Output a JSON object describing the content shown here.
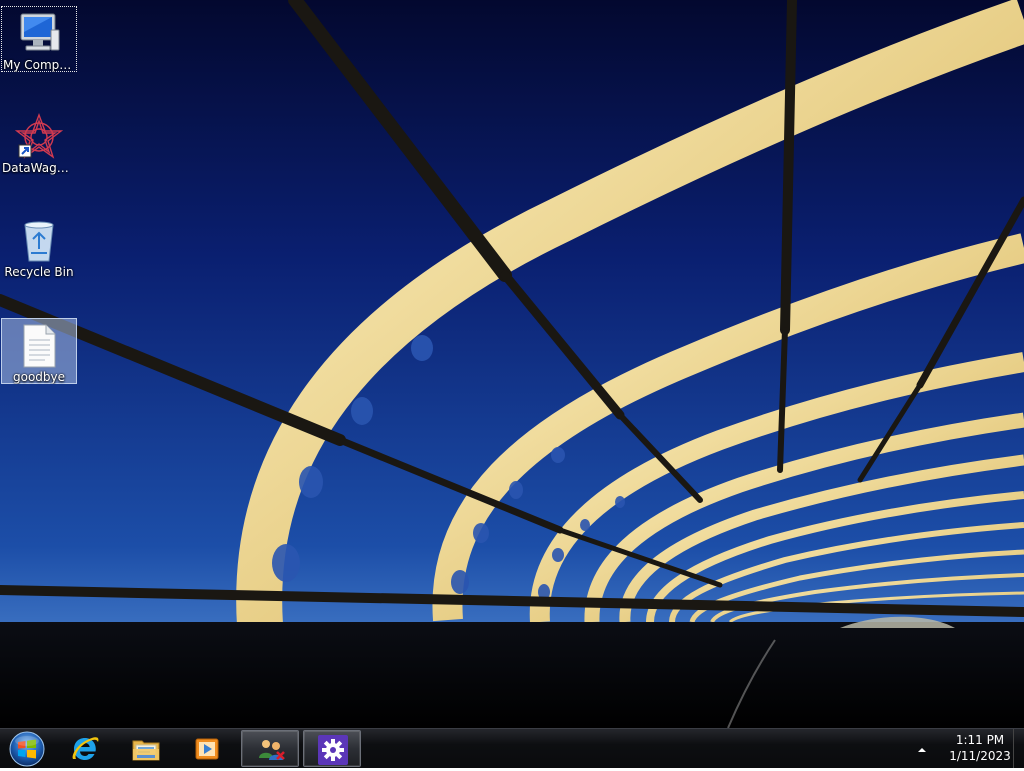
{
  "desktop": {
    "icons": [
      {
        "label": "My Computer",
        "icon": "computer-icon"
      },
      {
        "label": "DataWagon...",
        "icon": "datawagon-shortcut-icon"
      },
      {
        "label": "Recycle Bin",
        "icon": "recycle-bin-icon"
      },
      {
        "label": "goodbye",
        "icon": "text-file-icon"
      }
    ]
  },
  "taskbar": {
    "start": {
      "icon": "windows-start-orb-icon"
    },
    "pinned": [
      {
        "icon": "internet-explorer-icon",
        "active": false
      },
      {
        "icon": "file-explorer-icon",
        "active": false
      },
      {
        "icon": "media-player-icon",
        "active": false
      },
      {
        "icon": "network-users-icon",
        "active": true
      },
      {
        "icon": "settings-gear-icon",
        "active": true
      }
    ],
    "tray": {
      "arrow_icon": "show-hidden-icons-arrow-icon",
      "time": "1:11 PM",
      "date": "1/11/2023"
    }
  },
  "colors": {
    "sky_top": "#050a3a",
    "sky_bottom": "#1f54b0",
    "bridge_gold": "#efdca0",
    "taskbar": "#0d0e11"
  }
}
